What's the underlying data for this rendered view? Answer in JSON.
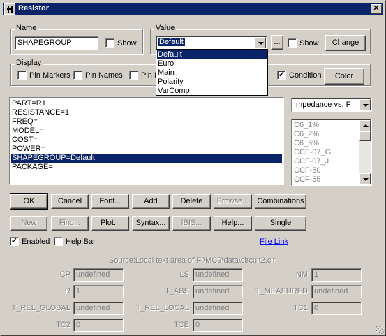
{
  "window": {
    "title": "Resistor"
  },
  "name_group": {
    "label": "Name",
    "value": "SHAPEGROUP",
    "show_label": "Show"
  },
  "value_group": {
    "label": "Value",
    "selected": "Default",
    "browse_label": "...",
    "show_label": "Show",
    "change_label": "Change",
    "options": [
      "Default",
      "Euro",
      "Main",
      "Polarity",
      "VarComp"
    ]
  },
  "display_group": {
    "label": "Display",
    "pin_markers": "Pin Markers",
    "pin_names": "Pin Names",
    "pin_numbers_partial": "Pin N",
    "condition": "Condition",
    "color": "Color"
  },
  "attributes": [
    "PART=R1",
    "RESISTANCE=1",
    "FREQ=",
    "MODEL=",
    "COST=",
    "POWER=",
    "SHAPEGROUP=Default",
    "PACKAGE="
  ],
  "plot_select": {
    "value": "Impedance vs. F"
  },
  "models": [
    "C6_1%",
    "C6_2%",
    "C6_5%",
    "CCF-07_G",
    "CCF-07_J",
    "CCF-50",
    "CCF-55"
  ],
  "buttons_row1": [
    "OK",
    "Cancel",
    "Font...",
    "Add",
    "Delete",
    "Browse...",
    "Combinations"
  ],
  "buttons_row2": [
    "New",
    "Find...",
    "Plot...",
    "Syntax...",
    "IBIS...",
    "Help...",
    "Single"
  ],
  "enabled_label": "Enabled",
  "helpbar_label": "Help Bar",
  "file_link": "File Link",
  "source_text": "Source:Local text area of F:\\MC9\\data\\circuit2.cir",
  "params": {
    "cp": {
      "label": "CP",
      "value": "undefined"
    },
    "ls": {
      "label": "LS",
      "value": "undefined"
    },
    "nm": {
      "label": "NM",
      "value": "1"
    },
    "r": {
      "label": "R",
      "value": "1"
    },
    "t_abs": {
      "label": "T_ABS",
      "value": "undefined"
    },
    "t_measured": {
      "label": "T_MEASURED",
      "value": "undefined"
    },
    "t_rel_global": {
      "label": "T_REL_GLOBAL",
      "value": "undefined"
    },
    "t_rel_local": {
      "label": "T_REL_LOCAL",
      "value": "undefined"
    },
    "tc1": {
      "label": "TC1",
      "value": "0"
    },
    "tc2": {
      "label": "TC2",
      "value": "0"
    },
    "tce": {
      "label": "TCE",
      "value": "0"
    }
  }
}
